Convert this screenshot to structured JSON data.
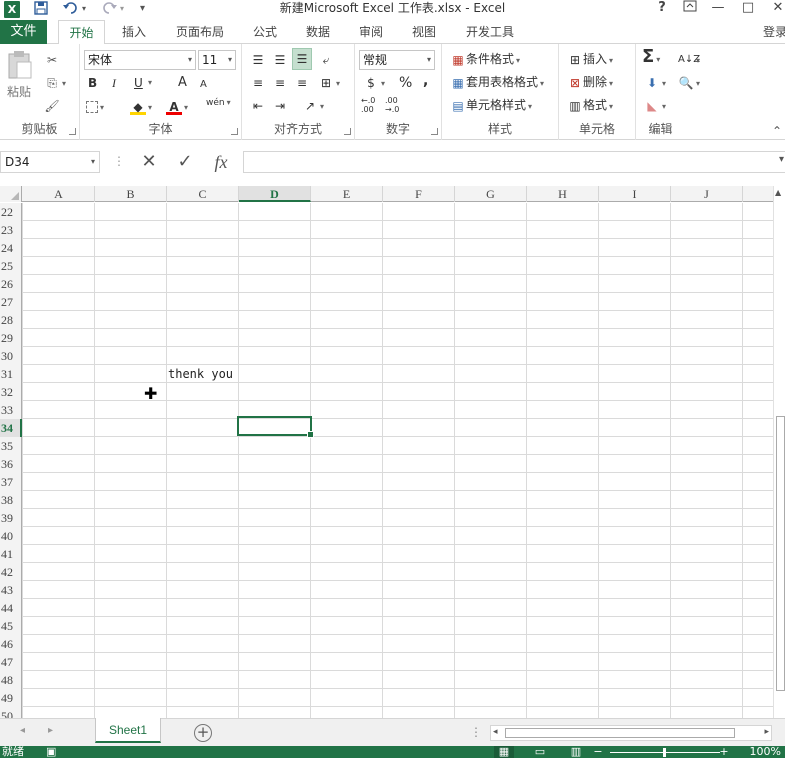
{
  "window": {
    "title": "新建Microsoft Excel 工作表.xlsx - Excel",
    "logo": "X",
    "help": "?",
    "minimize": "—",
    "restore": "□",
    "close": "✕"
  },
  "quick_access": {
    "save_icon": "save-icon",
    "undo_icon": "undo-icon",
    "redo_icon": "redo-icon"
  },
  "tabs": {
    "file": "文件",
    "items": [
      "开始",
      "插入",
      "页面布局",
      "公式",
      "数据",
      "审阅",
      "视图",
      "开发工具"
    ],
    "active": "开始",
    "signin": "登录"
  },
  "ribbon": {
    "clipboard": {
      "label": "剪贴板",
      "paste": "粘贴"
    },
    "font": {
      "label": "字体",
      "font_name": "宋体",
      "font_size": "11",
      "bold": "B",
      "italic": "I",
      "underline": "U",
      "grow": "A",
      "shrink": "A",
      "phonetic": "wén"
    },
    "alignment": {
      "label": "对齐方式"
    },
    "number": {
      "label": "数字",
      "format": "常规",
      "percent": "%",
      "comma": ","
    },
    "styles": {
      "label": "样式",
      "conditional": "条件格式",
      "table": "套用表格格式",
      "cell": "单元格样式"
    },
    "cells": {
      "label": "单元格",
      "insert": "插入",
      "delete": "删除",
      "format": "格式"
    },
    "editing": {
      "label": "编辑",
      "sum": "Σ"
    }
  },
  "formula_bar": {
    "name_box": "D34",
    "cancel": "✕",
    "enter": "✓",
    "fx": "fx",
    "value": ""
  },
  "grid": {
    "columns": [
      "A",
      "B",
      "C",
      "D",
      "E",
      "F",
      "G",
      "H",
      "I",
      "J"
    ],
    "active_column": "D",
    "rows": [
      "22",
      "23",
      "24",
      "25",
      "26",
      "27",
      "28",
      "29",
      "30",
      "31",
      "32",
      "33",
      "34",
      "35",
      "36",
      "37",
      "38",
      "39",
      "40",
      "41",
      "42",
      "43",
      "44",
      "45",
      "46",
      "47",
      "48",
      "49",
      "50"
    ],
    "active_row": "34",
    "cells": {
      "C31": "thenk you"
    },
    "selected_cell": "D34"
  },
  "sheets": {
    "tabs": [
      "Sheet1"
    ],
    "active": "Sheet1",
    "add": "+"
  },
  "status": {
    "ready": "就绪",
    "zoom": "100%"
  }
}
